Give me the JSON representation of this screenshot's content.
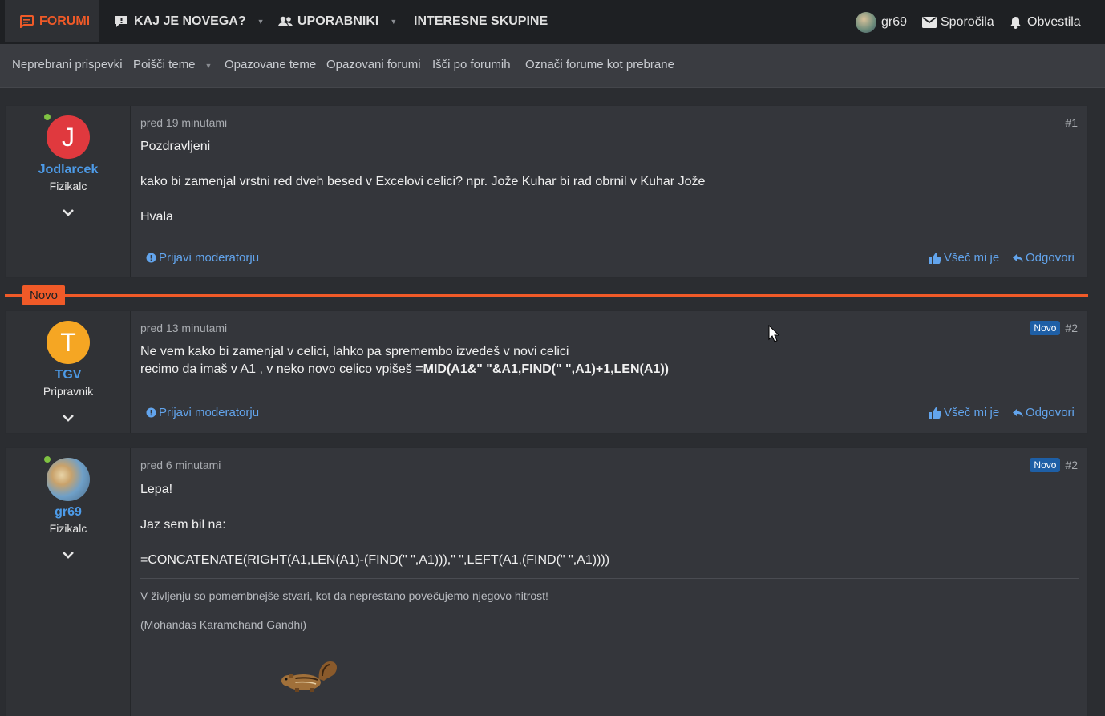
{
  "topnav": {
    "items": [
      {
        "label": "FORUMI",
        "icon": "chat-icon",
        "active": true
      },
      {
        "label": "KAJ JE NOVEGA?",
        "icon": "alert-bubble-icon"
      },
      {
        "label": "UPORABNIKI",
        "icon": "users-icon"
      },
      {
        "label": "INTERESNE SKUPINE"
      }
    ],
    "user": "gr69",
    "messages": "Sporočila",
    "alerts": "Obvestila"
  },
  "subnav": {
    "items": [
      "Neprebrani prispevki",
      "Poišči teme",
      "Opazovane teme",
      "Opazovani forumi",
      "Išči po forumih",
      "Označi forume kot prebrane"
    ]
  },
  "colors": {
    "accent": "#f05a28",
    "link": "#62a4ec",
    "username": "#4d9be8",
    "badge": "#1e5fa6",
    "online": "#7fc242"
  },
  "divider_label": "Novo",
  "posts": [
    {
      "author": "Jodlarcek",
      "title": "Fizikalc",
      "initial": "J",
      "avatar_color": "#e0393e",
      "online": true,
      "time": "pred 19 minutami",
      "num": "#1",
      "lines": [
        "Pozdravljeni",
        "kako bi zamenjal vrstni red dveh besed v Excelovi celici? npr. Jože Kuhar bi rad obrnil v Kuhar Jože",
        "Hvala"
      ],
      "report": "Prijavi moderatorju",
      "like": "Všeč mi je",
      "reply": "Odgovori"
    },
    {
      "author": "TGV",
      "title": "Pripravnik",
      "initial": "T",
      "avatar_color": "#f5a623",
      "online": false,
      "time": "pred 13 minutami",
      "num": "#2",
      "badge": "Novo",
      "line1": "Ne vem kako bi zamenjal v celici, lahko pa spremembo izvedeš v novi celici",
      "line2_plain": "recimo da imaš v A1 , v neko novo celico vpišeš ",
      "line2_bold": "=MID(A1&\" \"&A1,FIND(\" \",A1)+1,LEN(A1))",
      "report": "Prijavi moderatorju",
      "like": "Všeč mi je",
      "reply": "Odgovori"
    },
    {
      "author": "gr69",
      "title": "Fizikalc",
      "online": true,
      "time": "pred 6 minutami",
      "num": "#2",
      "badge": "Novo",
      "lines": [
        "Lepa!",
        "Jaz sem bil na:",
        "=CONCATENATE(RIGHT(A1,LEN(A1)-(FIND(\" \",A1))),\" \",LEFT(A1,(FIND(\" \",A1))))"
      ],
      "signature": [
        "V življenju so pomembnejše stvari, kot da neprestano povečujemo njegovo hitrost!",
        "(Mohandas Karamchand Gandhi)"
      ]
    }
  ]
}
